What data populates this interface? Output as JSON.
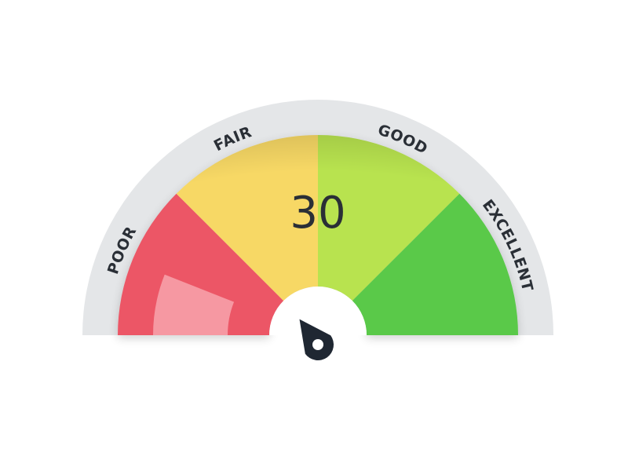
{
  "gauge": {
    "value": 30,
    "value_text": "30",
    "range": [
      0,
      100
    ],
    "zones": [
      {
        "label": "POOR",
        "from": 0,
        "to": 25,
        "color": "#ec5766"
      },
      {
        "label": "FAIR",
        "from": 25,
        "to": 50,
        "color": "#f7d865"
      },
      {
        "label": "GOOD",
        "from": 50,
        "to": 75,
        "color": "#b8e350"
      },
      {
        "label": "EXCELLENT",
        "from": 75,
        "to": 100,
        "color": "#5ac94a"
      }
    ],
    "colors": {
      "rim": "#e4e6e8",
      "text": "#2a2f36",
      "hub": "#ffffff",
      "needle": "#1f2732",
      "highlight": "#f7a0a8"
    },
    "icons": {
      "needle": "needle-pointer-icon"
    }
  }
}
